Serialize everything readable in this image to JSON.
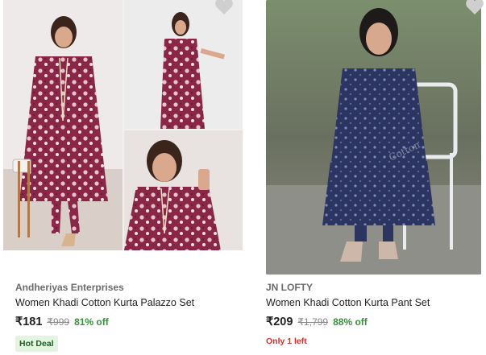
{
  "products": [
    {
      "brand": "Andheriyas Enterprises",
      "name": "Women Khadi Cotton Kurta Palazzo Set",
      "price": "₹181",
      "mrp": "₹999",
      "discount": "81% off",
      "badge": "Hot Deal",
      "image_icon": "product-image",
      "wishlist_icon": "heart-icon"
    },
    {
      "brand": "JN LOFTY",
      "name": "Women Khadi Cotton Kurta Pant Set",
      "price": "₹209",
      "mrp": "₹1,799",
      "discount": "88% off",
      "badge": "Only 1 left",
      "image_icon": "product-image",
      "wishlist_icon": "heart-icon"
    }
  ],
  "colors": {
    "price": "#212121",
    "discount": "#388e3c",
    "hot_deal_text": "#1b5e20",
    "hot_deal_bg": "#e3f4e1",
    "only_left": "#d32f2f",
    "brand": "#6b6b6b"
  }
}
